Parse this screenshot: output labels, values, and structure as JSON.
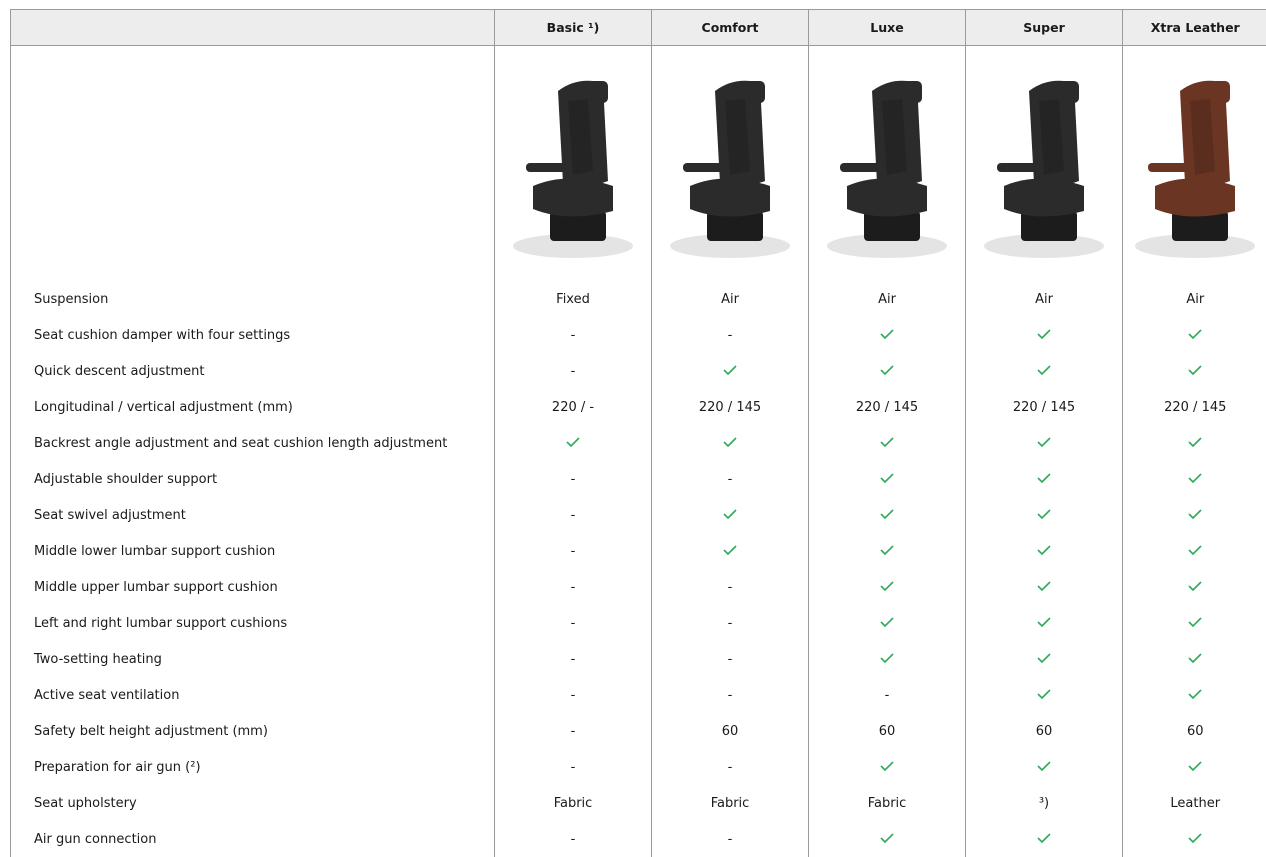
{
  "columns": [
    "Basic ¹)",
    "Comfort",
    "Luxe",
    "Super",
    "Xtra Leather"
  ],
  "seat_colors": {
    "standard": "#2b2b2b",
    "leather": "#6b3524"
  },
  "check_color": "#2faa5a",
  "rows": [
    {
      "label": "Suspension",
      "values": [
        "Fixed",
        "Air",
        "Air",
        "Air",
        "Air"
      ]
    },
    {
      "label": "Seat cushion damper with four settings",
      "values": [
        "-",
        "-",
        "check",
        "check",
        "check"
      ]
    },
    {
      "label": "Quick descent adjustment",
      "values": [
        "-",
        "check",
        "check",
        "check",
        "check"
      ]
    },
    {
      "label": "Longitudinal / vertical adjustment (mm)",
      "values": [
        "220 / -",
        "220 / 145",
        "220 / 145",
        "220 / 145",
        "220 / 145"
      ]
    },
    {
      "label": "Backrest angle adjustment and seat cushion length adjustment",
      "values": [
        "check",
        "check",
        "check",
        "check",
        "check"
      ]
    },
    {
      "label": "Adjustable shoulder support",
      "values": [
        "-",
        "-",
        "check",
        "check",
        "check"
      ]
    },
    {
      "label": "Seat swivel adjustment",
      "values": [
        "-",
        "check",
        "check",
        "check",
        "check"
      ]
    },
    {
      "label": "Middle lower lumbar support cushion",
      "values": [
        "-",
        "check",
        "check",
        "check",
        "check"
      ]
    },
    {
      "label": "Middle upper lumbar support cushion",
      "values": [
        "-",
        "-",
        "check",
        "check",
        "check"
      ]
    },
    {
      "label": "Left and right lumbar support cushions",
      "values": [
        "-",
        "-",
        "check",
        "check",
        "check"
      ]
    },
    {
      "label": "Two-setting heating",
      "values": [
        "-",
        "-",
        "check",
        "check",
        "check"
      ]
    },
    {
      "label": "Active seat ventilation",
      "values": [
        "-",
        "-",
        "-",
        "check",
        "check"
      ]
    },
    {
      "label": "Safety belt height adjustment (mm)",
      "values": [
        "-",
        "60",
        "60",
        "60",
        "60"
      ]
    },
    {
      "label": "Preparation for air gun (²)",
      "values": [
        "-",
        "-",
        "check",
        "check",
        "check"
      ]
    },
    {
      "label": "Seat upholstery",
      "values": [
        "Fabric",
        "Fabric",
        "Fabric",
        "³)",
        "Leather"
      ]
    },
    {
      "label": "Air gun connection",
      "values": [
        "-",
        "-",
        "check",
        "check",
        "check"
      ]
    }
  ]
}
